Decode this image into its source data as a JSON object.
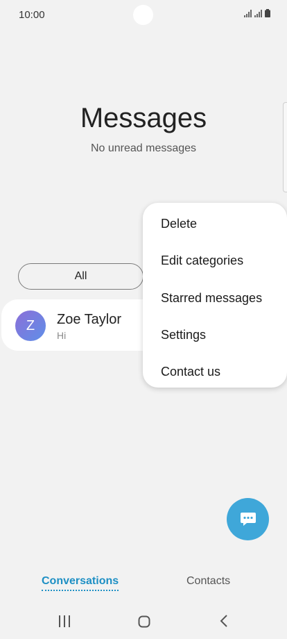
{
  "status_bar": {
    "time": "10:00",
    "icons": [
      "signal-icon",
      "signal-icon",
      "battery-icon"
    ]
  },
  "header": {
    "title": "Messages",
    "subtitle": "No unread messages"
  },
  "filters": {
    "all_label": "All"
  },
  "conversations": [
    {
      "avatar_letter": "Z",
      "name": "Zoe Taylor",
      "preview": "Hi"
    }
  ],
  "menu": {
    "items": [
      {
        "label": "Delete"
      },
      {
        "label": "Edit categories"
      },
      {
        "label": "Starred messages"
      },
      {
        "label": "Settings"
      },
      {
        "label": "Contact us"
      }
    ]
  },
  "fab": {
    "icon": "compose-chat-icon",
    "color": "#3fa7d9"
  },
  "bottom_tabs": {
    "conversations_label": "Conversations",
    "contacts_label": "Contacts",
    "active_color": "#1d8fc4"
  },
  "nav_bar": {
    "icons": [
      "recents-icon",
      "home-icon",
      "back-icon"
    ]
  }
}
